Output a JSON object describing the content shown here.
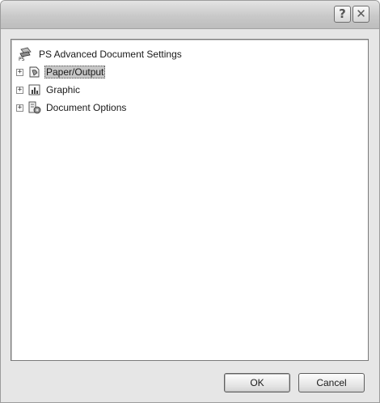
{
  "titlebar": {
    "help_glyph": "?",
    "close_glyph": "✕"
  },
  "tree": {
    "root": {
      "label": "PS Advanced Document Settings",
      "icon": "printer-ps-icon"
    },
    "items": [
      {
        "label": "Paper/Output",
        "icon": "paper-output-icon",
        "expander": "+",
        "selected": true
      },
      {
        "label": "Graphic",
        "icon": "graphic-icon",
        "expander": "+",
        "selected": false
      },
      {
        "label": "Document Options",
        "icon": "document-options-icon",
        "expander": "+",
        "selected": false
      }
    ]
  },
  "buttons": {
    "ok_label": "OK",
    "cancel_label": "Cancel"
  }
}
